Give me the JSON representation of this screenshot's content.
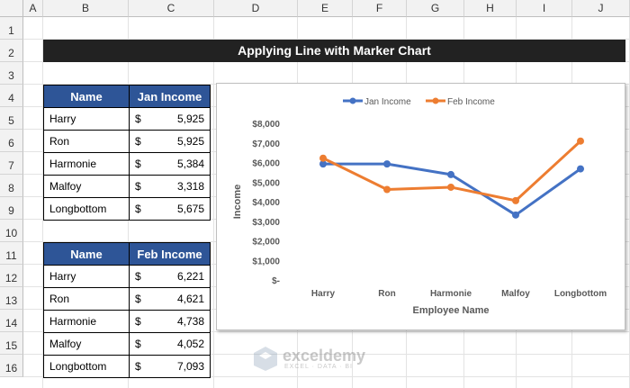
{
  "columns": [
    "A",
    "B",
    "C",
    "D",
    "E",
    "F",
    "G",
    "H",
    "I",
    "J"
  ],
  "rows": [
    "1",
    "2",
    "3",
    "4",
    "5",
    "6",
    "7",
    "8",
    "9",
    "10",
    "11",
    "12",
    "13",
    "14",
    "15",
    "16"
  ],
  "banner": "Applying Line with Marker Chart",
  "table_jan": {
    "headers": [
      "Name",
      "Jan Income"
    ],
    "rows": [
      {
        "name": "Harry",
        "cur": "$",
        "value": "5,925"
      },
      {
        "name": "Ron",
        "cur": "$",
        "value": "5,925"
      },
      {
        "name": "Harmonie",
        "cur": "$",
        "value": "5,384"
      },
      {
        "name": "Malfoy",
        "cur": "$",
        "value": "3,318"
      },
      {
        "name": "Longbottom",
        "cur": "$",
        "value": "5,675"
      }
    ]
  },
  "table_feb": {
    "headers": [
      "Name",
      "Feb Income"
    ],
    "rows": [
      {
        "name": "Harry",
        "cur": "$",
        "value": "6,221"
      },
      {
        "name": "Ron",
        "cur": "$",
        "value": "4,621"
      },
      {
        "name": "Harmonie",
        "cur": "$",
        "value": "4,738"
      },
      {
        "name": "Malfoy",
        "cur": "$",
        "value": "4,052"
      },
      {
        "name": "Longbottom",
        "cur": "$",
        "value": "7,093"
      }
    ]
  },
  "chart_data": {
    "type": "line",
    "categories": [
      "Harry",
      "Ron",
      "Harmonie",
      "Malfoy",
      "Longbottom"
    ],
    "series": [
      {
        "name": "Jan Income",
        "color": "#4472c4",
        "values": [
          5925,
          5925,
          5384,
          3318,
          5675
        ]
      },
      {
        "name": "Feb Income",
        "color": "#ed7d31",
        "values": [
          6221,
          4621,
          4738,
          4052,
          7093
        ]
      }
    ],
    "xlabel": "Employee Name",
    "ylabel": "Income",
    "ylim": [
      0,
      8000
    ],
    "yticks": [
      "$-",
      "$1,000",
      "$2,000",
      "$3,000",
      "$4,000",
      "$5,000",
      "$6,000",
      "$7,000",
      "$8,000"
    ],
    "legend_position": "top",
    "grid": false
  },
  "watermark": {
    "brand": "exceldemy",
    "tagline": "EXCEL · DATA · BI"
  }
}
